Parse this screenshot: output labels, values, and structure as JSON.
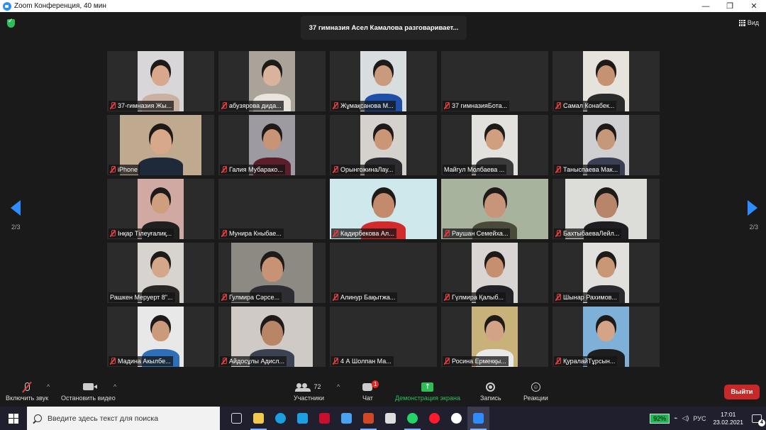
{
  "window": {
    "title": "Zoom Конференция, 40 мин",
    "minimize": "—",
    "restore": "❐",
    "close": "✕"
  },
  "stage": {
    "speaker_banner": "37 гимназия Асел Камалова разговаривает...",
    "view_label": "Вид",
    "page_left": "2/3",
    "page_right": "2/3"
  },
  "participants": [
    {
      "name": "37-гимназия Жы...",
      "muted": true,
      "video": {
        "x": 43,
        "w": 65,
        "bg": "#d8d6d8",
        "skin": "#d9a88c",
        "cloth": "#c9b0a0"
      }
    },
    {
      "name": "абузярова дида...",
      "muted": true,
      "video": {
        "x": 43,
        "w": 65,
        "bg": "#a9a39a",
        "skin": "#d9b39b",
        "cloth": "#e8e4dc"
      }
    },
    {
      "name": "Жұмақсанова М...",
      "muted": true,
      "video": {
        "x": 43,
        "w": 65,
        "bg": "#d8dde0",
        "skin": "#c99a7c",
        "cloth": "#1f4fa8"
      }
    },
    {
      "name": "37 гимназияБота...",
      "muted": true,
      "video": null
    },
    {
      "name": "Самал Конабек...",
      "muted": true,
      "video": {
        "x": 43,
        "w": 65,
        "bg": "#e6e2dc",
        "skin": "#c59373",
        "cloth": "#2a2a2a"
      }
    },
    {
      "name": "iPhone",
      "muted": true,
      "video": {
        "x": 18,
        "w": 115,
        "bg": "#bfa98f",
        "skin": "#d7a98a",
        "cloth": "#1e2a3a"
      }
    },
    {
      "name": "Галия Мубарако...",
      "muted": true,
      "video": {
        "x": 43,
        "w": 65,
        "bg": "#9e9aa2",
        "skin": "#c79475",
        "cloth": "#5a1f2a"
      }
    },
    {
      "name": "ОрынгожинаЛау...",
      "muted": true,
      "video": {
        "x": 43,
        "w": 65,
        "bg": "#d5d1cd",
        "skin": "#c99676",
        "cloth": "#2c2c30"
      }
    },
    {
      "name": "Майгул Молбаева ...",
      "muted": false,
      "video": {
        "x": 43,
        "w": 65,
        "bg": "#e3e1de",
        "skin": "#cf9f80",
        "cloth": "#3a3a3a"
      }
    },
    {
      "name": "Таныспаева Мак...",
      "muted": true,
      "video": {
        "x": 43,
        "w": 65,
        "bg": "#cfcfd2",
        "skin": "#c5987a",
        "cloth": "#3a3f55"
      }
    },
    {
      "name": "Інқар Тілеуғалиқ...",
      "muted": true,
      "video": {
        "x": 43,
        "w": 65,
        "bg": "#d1a9a3",
        "skin": "#cf9e7f",
        "cloth": "#202020"
      }
    },
    {
      "name": "Мунира Кныбае...",
      "muted": true,
      "video": null
    },
    {
      "name": "Кадирбекова Ал...",
      "muted": true,
      "video": {
        "x": 0,
        "w": 151,
        "bg": "#cfe8ec",
        "skin": "#c48a6d",
        "cloth": "#d12b2b"
      }
    },
    {
      "name": "Раушан Семейха...",
      "muted": true,
      "video": {
        "x": 0,
        "w": 151,
        "bg": "#a7b39c",
        "skin": "#c9957a",
        "cloth": "#4a4a3a"
      }
    },
    {
      "name": "БахтыбаеваЛейл...",
      "muted": true,
      "video": {
        "x": 18,
        "w": 115,
        "bg": "#dcdcd8",
        "skin": "#b9856a",
        "cloth": "#1e1e22"
      }
    },
    {
      "name": "Рашкен Меруерт 8\"...",
      "muted": false,
      "video": {
        "x": 43,
        "w": 65,
        "bg": "#d7d4cf",
        "skin": "#d5a78a",
        "cloth": "#2b2626"
      }
    },
    {
      "name": "Гулмира Сәрсе...",
      "muted": true,
      "video": {
        "x": 18,
        "w": 115,
        "bg": "#8d8a84",
        "skin": "#c79374",
        "cloth": "#2d2d33"
      }
    },
    {
      "name": "Алинур Бақытжа...",
      "muted": true,
      "video": null
    },
    {
      "name": "Гүлмира Қалыб...",
      "muted": true,
      "video": {
        "x": 43,
        "w": 65,
        "bg": "#d8d5d2",
        "skin": "#c58f70",
        "cloth": "#222226"
      }
    },
    {
      "name": "Шынар Рахимов...",
      "muted": true,
      "video": {
        "x": 43,
        "w": 65,
        "bg": "#e2e0dc",
        "skin": "#c99676",
        "cloth": "#2a2a2e"
      }
    },
    {
      "name": "Мадина Акылбе...",
      "muted": true,
      "video": {
        "x": 43,
        "w": 65,
        "bg": "#e8e8e8",
        "skin": "#cb9a7b",
        "cloth": "#2f6fb8"
      }
    },
    {
      "name": "Айдосұлы Адисл...",
      "muted": true,
      "video": {
        "x": 18,
        "w": 115,
        "bg": "#cfcac5",
        "skin": "#b98567",
        "cloth": "#3b4252"
      }
    },
    {
      "name": "4 А Шолпан Ма...",
      "muted": true,
      "video": null
    },
    {
      "name": "Росина Ермекқы...",
      "muted": true,
      "video": {
        "x": 43,
        "w": 65,
        "bg": "#c9b27a",
        "skin": "#d2a386",
        "cloth": "#e9e9e9"
      }
    },
    {
      "name": "ҚуралайТұрсын...",
      "muted": true,
      "video": {
        "x": 43,
        "w": 65,
        "bg": "#7fb0d8",
        "skin": "#d3a487",
        "cloth": "#1e1e1e"
      }
    }
  ],
  "toolbar": {
    "unmute_label": "Включить звук",
    "stop_video_label": "Остановить видео",
    "participants_label": "Участники",
    "participants_count": "72",
    "chat_label": "Чат",
    "chat_badge": "1",
    "share_label": "Демонстрация экрана",
    "record_label": "Запись",
    "reactions_label": "Реакции",
    "leave_label": "Выйти",
    "caret": "^"
  },
  "taskbar": {
    "search_placeholder": "Введите здесь текст для поиска",
    "battery": "92%",
    "language": "РУС",
    "time": "17:01",
    "date": "23.02.2021",
    "notifications": "4",
    "apps": [
      {
        "name": "task-view",
        "color": "#dddddd"
      },
      {
        "name": "file-explorer",
        "color": "#f2c94c"
      },
      {
        "name": "edge",
        "color": "#1a9fe0"
      },
      {
        "name": "l-app",
        "color": "#1ba1e2"
      },
      {
        "name": "mcafee",
        "color": "#c8102e"
      },
      {
        "name": "mail",
        "color": "#4aa3f0"
      },
      {
        "name": "powerpoint",
        "color": "#d24726"
      },
      {
        "name": "store",
        "color": "#dddddd"
      },
      {
        "name": "whatsapp",
        "color": "#25d366"
      },
      {
        "name": "opera",
        "color": "#ff1b2d"
      },
      {
        "name": "yandex",
        "color": "#ffffff"
      },
      {
        "name": "zoom",
        "color": "#2d8cff"
      }
    ]
  }
}
